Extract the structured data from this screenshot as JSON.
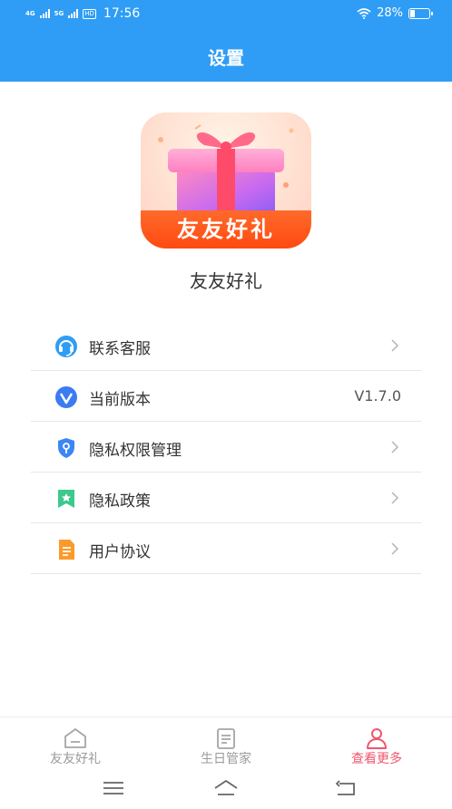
{
  "status_bar": {
    "network_1": "4G",
    "network_2": "5G",
    "hd_badge": "HD",
    "time": "17:56",
    "battery_percent": "28%",
    "battery_level": 0.28
  },
  "header": {
    "title": "设置"
  },
  "app": {
    "logo_text": "友友好礼",
    "name": "友友好礼"
  },
  "settings": [
    {
      "label": "联系客服",
      "icon": "headset-icon",
      "value": ""
    },
    {
      "label": "当前版本",
      "icon": "version-icon",
      "value": "V1.7.0"
    },
    {
      "label": "隐私权限管理",
      "icon": "shield-icon",
      "value": ""
    },
    {
      "label": "隐私政策",
      "icon": "bookmark-star-icon",
      "value": ""
    },
    {
      "label": "用户协议",
      "icon": "document-icon",
      "value": ""
    }
  ],
  "tabbar": {
    "items": [
      {
        "label": "友友好礼",
        "icon": "home-icon",
        "active": false
      },
      {
        "label": "生日管家",
        "icon": "notes-icon",
        "active": false
      },
      {
        "label": "查看更多",
        "icon": "user-icon",
        "active": true
      }
    ]
  },
  "colors": {
    "primary": "#2f9df5",
    "active_tab": "#f0556e",
    "logo_orange": "#ff5a1e"
  }
}
